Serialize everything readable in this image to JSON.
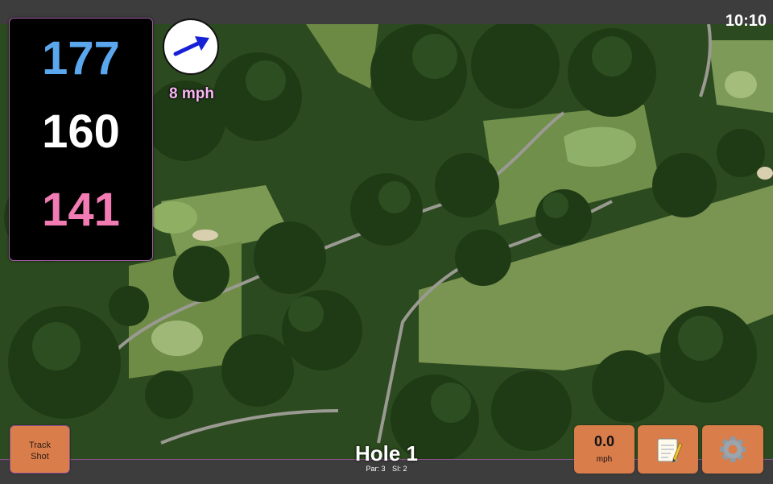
{
  "status_bar": {
    "time": "10:10"
  },
  "distances": {
    "back": "177",
    "middle": "160",
    "front": "141"
  },
  "wind": {
    "speed_label": "8 mph",
    "direction_icon": "wind-arrow-icon"
  },
  "hole": {
    "title": "Hole 1",
    "par_label": "Par: 3",
    "si_label": "SI: 2"
  },
  "buttons": {
    "track_shot_line1": "Track",
    "track_shot_line2": "Shot",
    "speed_value": "0.0",
    "speed_unit": "mph",
    "notes_icon": "notepad-icon",
    "settings_icon": "gear-icon"
  },
  "colors": {
    "back_distance": "#5aa7ee",
    "middle_distance": "#ffffff",
    "front_distance": "#f27bb3",
    "button": "#d97d4b",
    "wind_text": "#f9b6f3"
  }
}
